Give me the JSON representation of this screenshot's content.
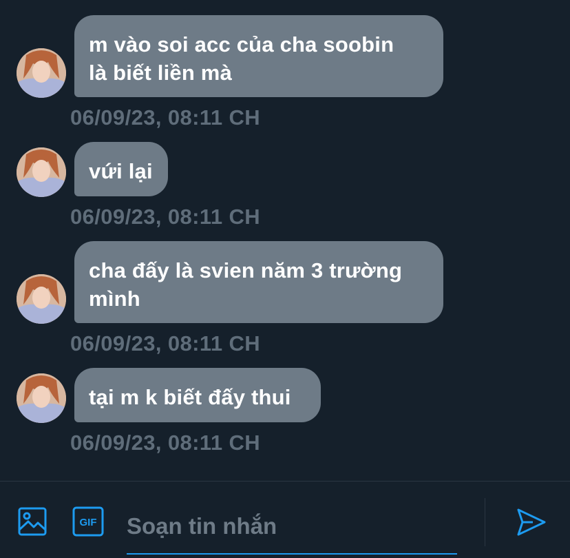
{
  "messages": [
    {
      "text": "m vào soi acc của cha soobin\nlà biết liền mà",
      "timestamp": "06/09/23, 08:11 CH"
    },
    {
      "text": "vứi lại",
      "timestamp": "06/09/23, 08:11 CH"
    },
    {
      "text": "cha đấy là svien năm 3 trường\nmình",
      "timestamp": "06/09/23, 08:11 CH"
    },
    {
      "text": "tại m k biết đấy thui",
      "timestamp": "06/09/23, 08:11 CH"
    }
  ],
  "composer": {
    "placeholder": "Soạn tin nhắn",
    "value": "",
    "media_icon": "image-icon",
    "gif_icon": "gif-icon",
    "gif_label": "GIF",
    "send_icon": "send-icon"
  },
  "colors": {
    "background": "#15202b",
    "bubble": "#6e7b87",
    "timestamp": "#5f6d7a",
    "accent": "#1d9bf0"
  }
}
